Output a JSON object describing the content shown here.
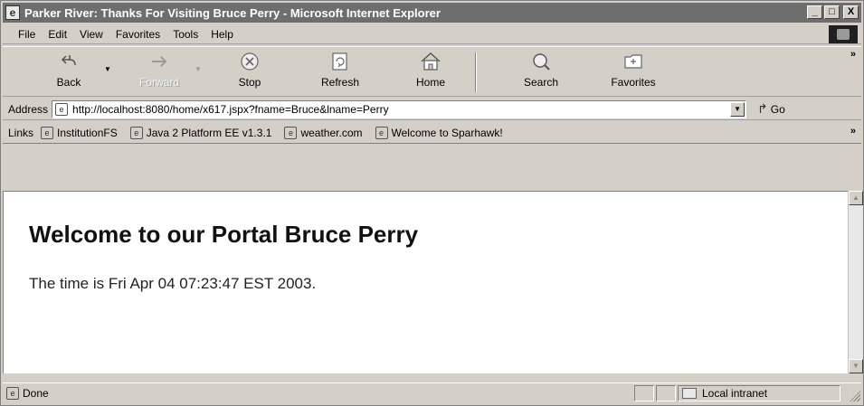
{
  "window": {
    "title": "Parker River: Thanks For Visiting Bruce Perry - Microsoft Internet Explorer",
    "minimize": "_",
    "maximize": "□",
    "close": "X"
  },
  "menu": {
    "items": [
      "File",
      "Edit",
      "View",
      "Favorites",
      "Tools",
      "Help"
    ]
  },
  "toolbar": {
    "back": "Back",
    "forward": "Forward",
    "stop": "Stop",
    "refresh": "Refresh",
    "home": "Home",
    "search": "Search",
    "favorites": "Favorites",
    "more": "»"
  },
  "address": {
    "label": "Address",
    "url": "http://localhost:8080/home/x617.jspx?fname=Bruce&lname=Perry",
    "go": "Go"
  },
  "links": {
    "label": "Links",
    "items": [
      "InstitutionFS",
      "Java 2 Platform EE v1.3.1",
      "weather.com",
      "Welcome to Sparhawk!"
    ],
    "more": "»"
  },
  "page": {
    "heading": "Welcome to our Portal Bruce Perry",
    "time": "The time is Fri Apr 04 07:23:47 EST 2003."
  },
  "status": {
    "text": "Done",
    "zone": "Local intranet"
  },
  "icons": {
    "page": "ie-page-icon",
    "back": "back-arrow-icon",
    "forward": "forward-arrow-icon",
    "stop": "stop-icon",
    "refresh": "refresh-icon",
    "home": "home-icon",
    "search": "search-icon",
    "favorites": "favorites-icon"
  }
}
